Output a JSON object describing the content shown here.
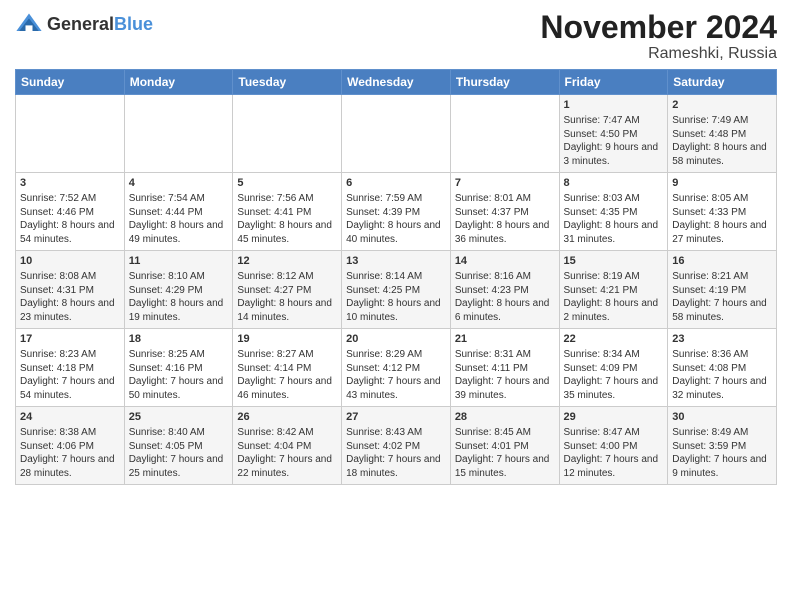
{
  "logo": {
    "general": "General",
    "blue": "Blue"
  },
  "title": "November 2024",
  "location": "Rameshki, Russia",
  "headers": [
    "Sunday",
    "Monday",
    "Tuesday",
    "Wednesday",
    "Thursday",
    "Friday",
    "Saturday"
  ],
  "weeks": [
    [
      {
        "day": "",
        "sunrise": "",
        "sunset": "",
        "daylight": ""
      },
      {
        "day": "",
        "sunrise": "",
        "sunset": "",
        "daylight": ""
      },
      {
        "day": "",
        "sunrise": "",
        "sunset": "",
        "daylight": ""
      },
      {
        "day": "",
        "sunrise": "",
        "sunset": "",
        "daylight": ""
      },
      {
        "day": "",
        "sunrise": "",
        "sunset": "",
        "daylight": ""
      },
      {
        "day": "1",
        "sunrise": "Sunrise: 7:47 AM",
        "sunset": "Sunset: 4:50 PM",
        "daylight": "Daylight: 9 hours and 3 minutes."
      },
      {
        "day": "2",
        "sunrise": "Sunrise: 7:49 AM",
        "sunset": "Sunset: 4:48 PM",
        "daylight": "Daylight: 8 hours and 58 minutes."
      }
    ],
    [
      {
        "day": "3",
        "sunrise": "Sunrise: 7:52 AM",
        "sunset": "Sunset: 4:46 PM",
        "daylight": "Daylight: 8 hours and 54 minutes."
      },
      {
        "day": "4",
        "sunrise": "Sunrise: 7:54 AM",
        "sunset": "Sunset: 4:44 PM",
        "daylight": "Daylight: 8 hours and 49 minutes."
      },
      {
        "day": "5",
        "sunrise": "Sunrise: 7:56 AM",
        "sunset": "Sunset: 4:41 PM",
        "daylight": "Daylight: 8 hours and 45 minutes."
      },
      {
        "day": "6",
        "sunrise": "Sunrise: 7:59 AM",
        "sunset": "Sunset: 4:39 PM",
        "daylight": "Daylight: 8 hours and 40 minutes."
      },
      {
        "day": "7",
        "sunrise": "Sunrise: 8:01 AM",
        "sunset": "Sunset: 4:37 PM",
        "daylight": "Daylight: 8 hours and 36 minutes."
      },
      {
        "day": "8",
        "sunrise": "Sunrise: 8:03 AM",
        "sunset": "Sunset: 4:35 PM",
        "daylight": "Daylight: 8 hours and 31 minutes."
      },
      {
        "day": "9",
        "sunrise": "Sunrise: 8:05 AM",
        "sunset": "Sunset: 4:33 PM",
        "daylight": "Daylight: 8 hours and 27 minutes."
      }
    ],
    [
      {
        "day": "10",
        "sunrise": "Sunrise: 8:08 AM",
        "sunset": "Sunset: 4:31 PM",
        "daylight": "Daylight: 8 hours and 23 minutes."
      },
      {
        "day": "11",
        "sunrise": "Sunrise: 8:10 AM",
        "sunset": "Sunset: 4:29 PM",
        "daylight": "Daylight: 8 hours and 19 minutes."
      },
      {
        "day": "12",
        "sunrise": "Sunrise: 8:12 AM",
        "sunset": "Sunset: 4:27 PM",
        "daylight": "Daylight: 8 hours and 14 minutes."
      },
      {
        "day": "13",
        "sunrise": "Sunrise: 8:14 AM",
        "sunset": "Sunset: 4:25 PM",
        "daylight": "Daylight: 8 hours and 10 minutes."
      },
      {
        "day": "14",
        "sunrise": "Sunrise: 8:16 AM",
        "sunset": "Sunset: 4:23 PM",
        "daylight": "Daylight: 8 hours and 6 minutes."
      },
      {
        "day": "15",
        "sunrise": "Sunrise: 8:19 AM",
        "sunset": "Sunset: 4:21 PM",
        "daylight": "Daylight: 8 hours and 2 minutes."
      },
      {
        "day": "16",
        "sunrise": "Sunrise: 8:21 AM",
        "sunset": "Sunset: 4:19 PM",
        "daylight": "Daylight: 7 hours and 58 minutes."
      }
    ],
    [
      {
        "day": "17",
        "sunrise": "Sunrise: 8:23 AM",
        "sunset": "Sunset: 4:18 PM",
        "daylight": "Daylight: 7 hours and 54 minutes."
      },
      {
        "day": "18",
        "sunrise": "Sunrise: 8:25 AM",
        "sunset": "Sunset: 4:16 PM",
        "daylight": "Daylight: 7 hours and 50 minutes."
      },
      {
        "day": "19",
        "sunrise": "Sunrise: 8:27 AM",
        "sunset": "Sunset: 4:14 PM",
        "daylight": "Daylight: 7 hours and 46 minutes."
      },
      {
        "day": "20",
        "sunrise": "Sunrise: 8:29 AM",
        "sunset": "Sunset: 4:12 PM",
        "daylight": "Daylight: 7 hours and 43 minutes."
      },
      {
        "day": "21",
        "sunrise": "Sunrise: 8:31 AM",
        "sunset": "Sunset: 4:11 PM",
        "daylight": "Daylight: 7 hours and 39 minutes."
      },
      {
        "day": "22",
        "sunrise": "Sunrise: 8:34 AM",
        "sunset": "Sunset: 4:09 PM",
        "daylight": "Daylight: 7 hours and 35 minutes."
      },
      {
        "day": "23",
        "sunrise": "Sunrise: 8:36 AM",
        "sunset": "Sunset: 4:08 PM",
        "daylight": "Daylight: 7 hours and 32 minutes."
      }
    ],
    [
      {
        "day": "24",
        "sunrise": "Sunrise: 8:38 AM",
        "sunset": "Sunset: 4:06 PM",
        "daylight": "Daylight: 7 hours and 28 minutes."
      },
      {
        "day": "25",
        "sunrise": "Sunrise: 8:40 AM",
        "sunset": "Sunset: 4:05 PM",
        "daylight": "Daylight: 7 hours and 25 minutes."
      },
      {
        "day": "26",
        "sunrise": "Sunrise: 8:42 AM",
        "sunset": "Sunset: 4:04 PM",
        "daylight": "Daylight: 7 hours and 22 minutes."
      },
      {
        "day": "27",
        "sunrise": "Sunrise: 8:43 AM",
        "sunset": "Sunset: 4:02 PM",
        "daylight": "Daylight: 7 hours and 18 minutes."
      },
      {
        "day": "28",
        "sunrise": "Sunrise: 8:45 AM",
        "sunset": "Sunset: 4:01 PM",
        "daylight": "Daylight: 7 hours and 15 minutes."
      },
      {
        "day": "29",
        "sunrise": "Sunrise: 8:47 AM",
        "sunset": "Sunset: 4:00 PM",
        "daylight": "Daylight: 7 hours and 12 minutes."
      },
      {
        "day": "30",
        "sunrise": "Sunrise: 8:49 AM",
        "sunset": "Sunset: 3:59 PM",
        "daylight": "Daylight: 7 hours and 9 minutes."
      }
    ]
  ]
}
